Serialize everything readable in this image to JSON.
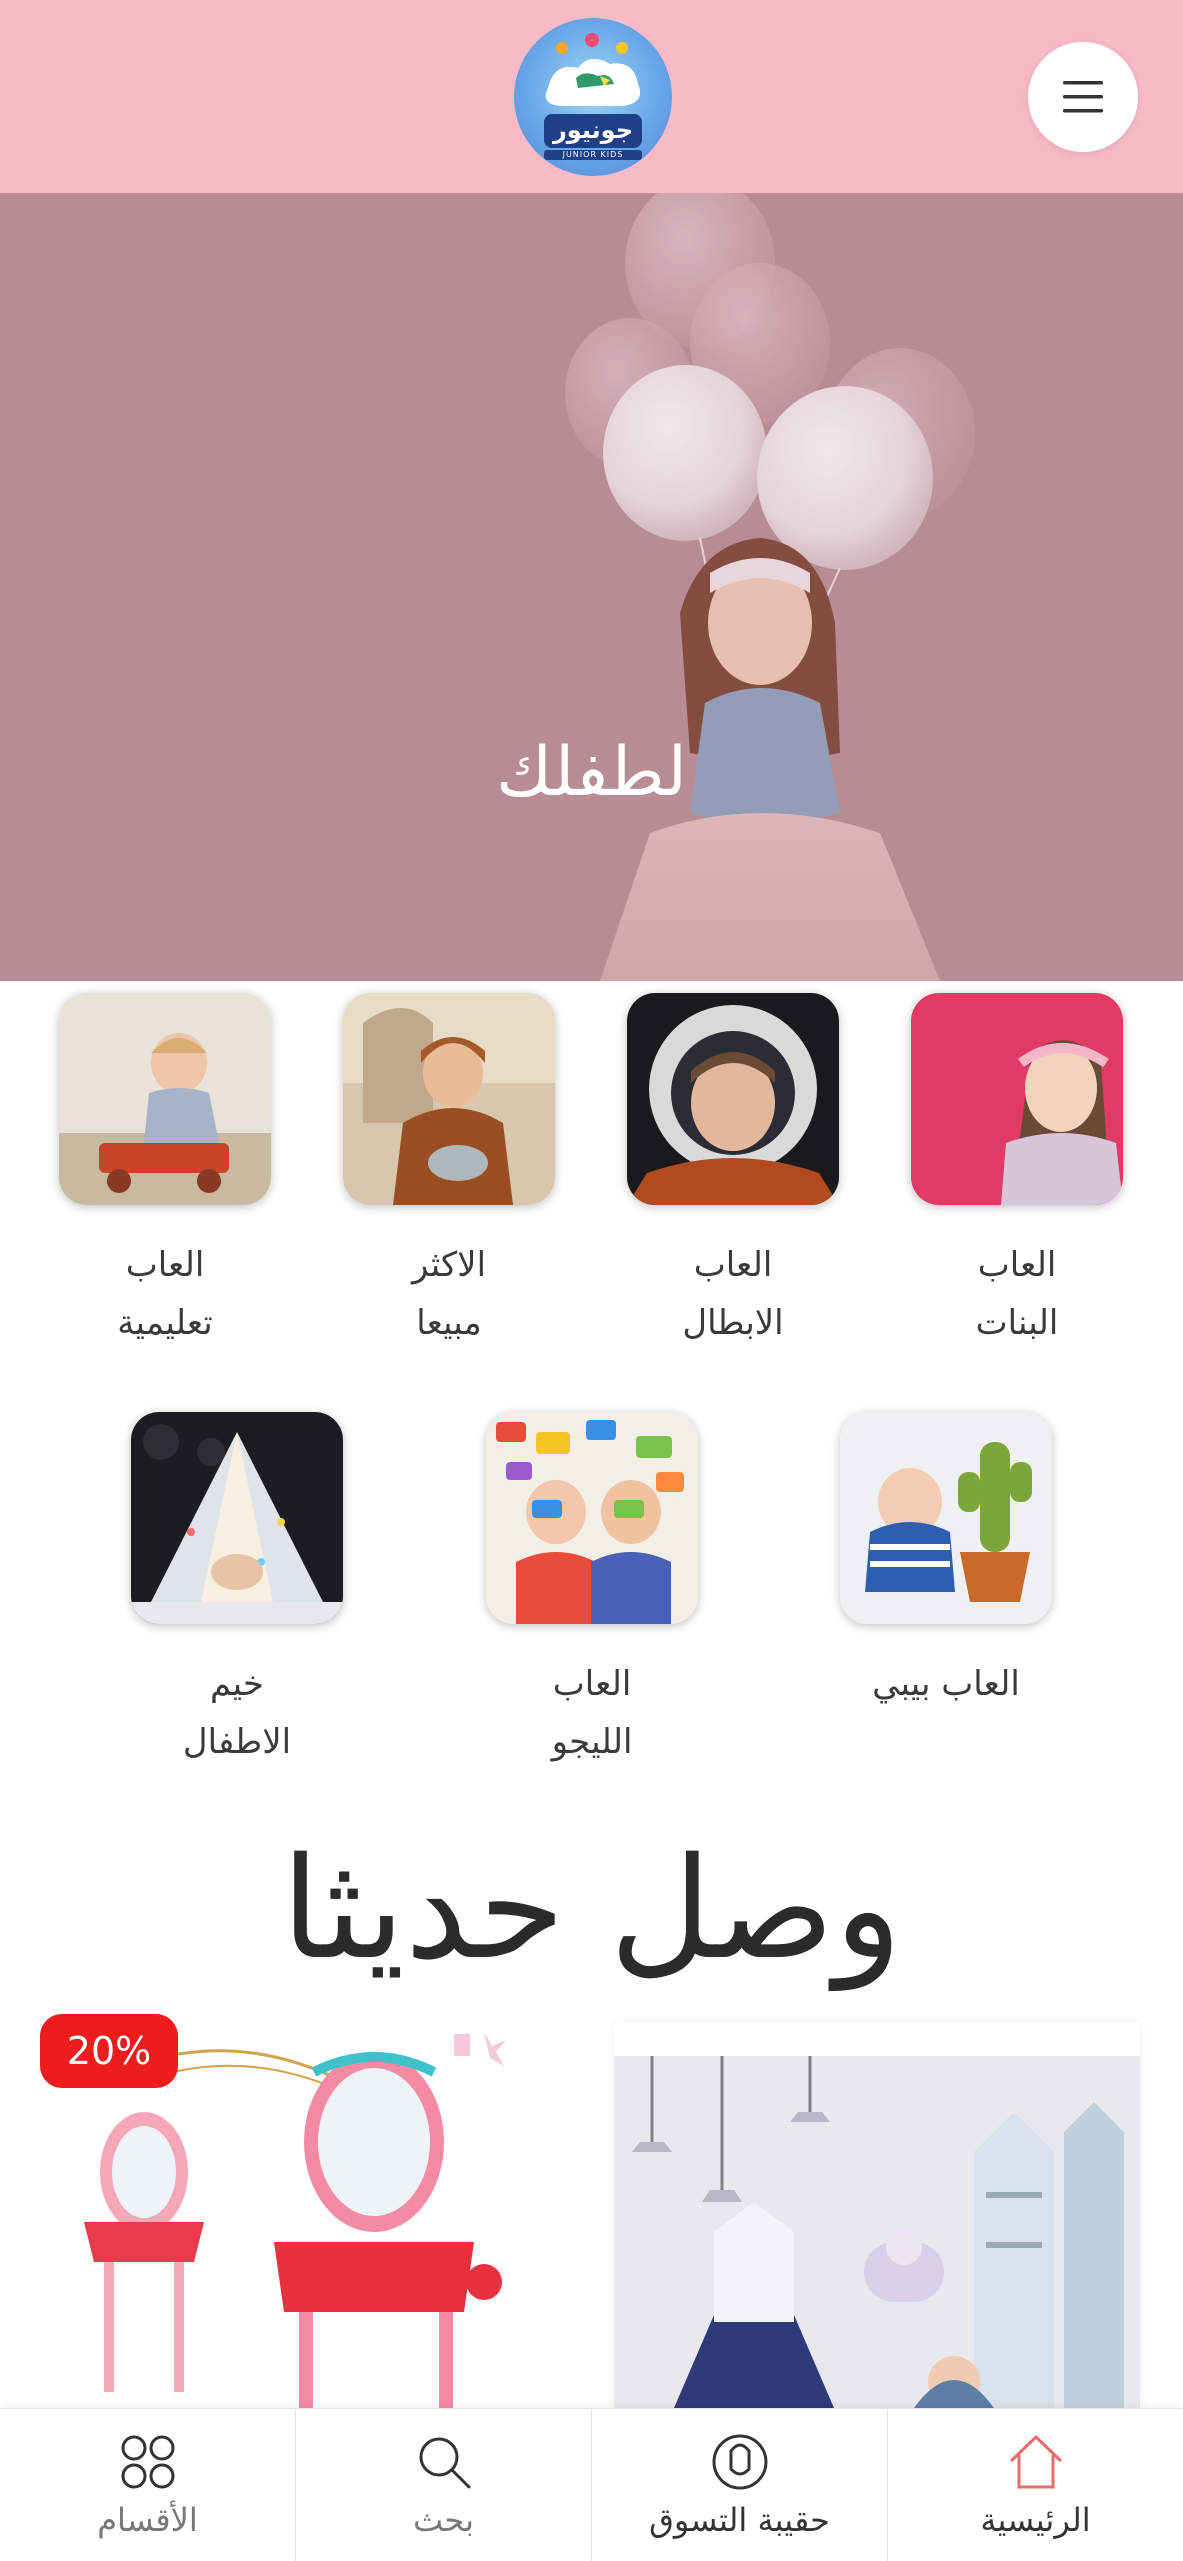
{
  "header": {
    "logo_text": "جونيور",
    "logo_subtext": "JUNIOR KIDS",
    "menu_icon": "hamburger-icon"
  },
  "hero": {
    "title": "لطفلك"
  },
  "categories": [
    {
      "line1": "العاب",
      "line2": "البنات"
    },
    {
      "line1": "العاب",
      "line2": "الابطال"
    },
    {
      "line1": "الاكثر",
      "line2": "مبيعا"
    },
    {
      "line1": "العاب",
      "line2": "تعليمية"
    },
    {
      "line1": "العاب بيبي",
      "line2": ""
    },
    {
      "line1": "العاب",
      "line2": "الليجو"
    },
    {
      "line1": "خيم",
      "line2": "الاطفال"
    }
  ],
  "new_arrivals": {
    "title": "وصل حديثا",
    "discount_badge": "20%"
  },
  "bottom_nav": [
    {
      "label": "الرئيسية",
      "icon": "home-icon"
    },
    {
      "label": "حقيبة التسوق",
      "icon": "shopping-bag-icon"
    },
    {
      "label": "بحث",
      "icon": "search-icon"
    },
    {
      "label": "الأقسام",
      "icon": "categories-grid-icon"
    }
  ],
  "colors": {
    "header_bg": "#f7bac6",
    "badge_red": "#ee1c1c",
    "home_icon": "#e86a6a"
  }
}
